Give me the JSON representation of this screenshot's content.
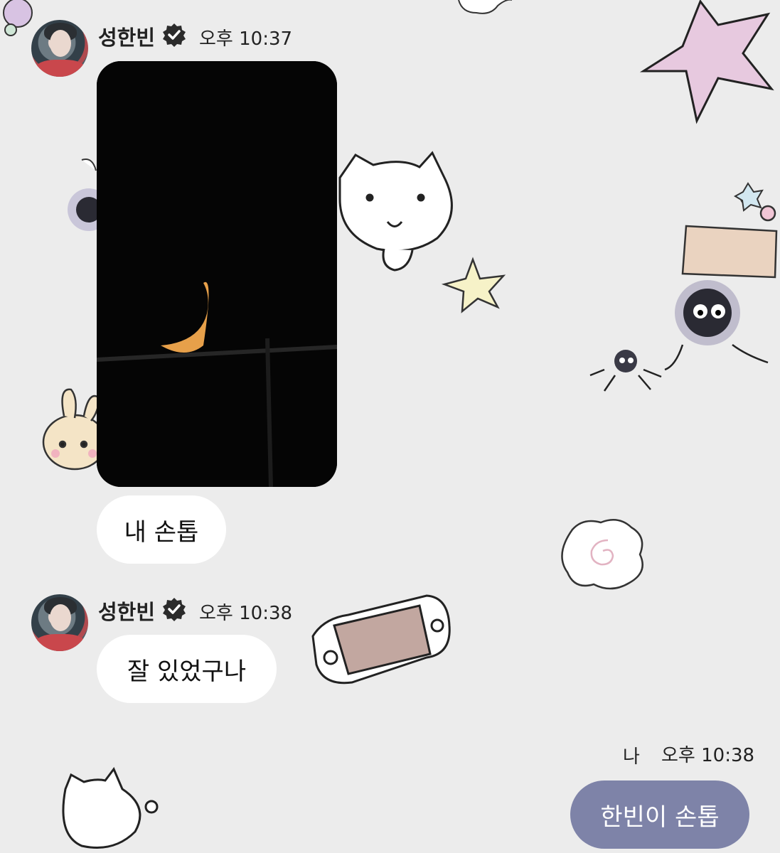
{
  "messages": [
    {
      "sender": "성한빈",
      "time": "오후 10:37",
      "items": [
        "내 손톱"
      ]
    },
    {
      "sender": "성한빈",
      "time": "오후 10:38",
      "items": [
        "잘 있었구나"
      ]
    }
  ],
  "my_message": {
    "me_label": "나",
    "time": "오후 10:38",
    "text": "한빈이 손톱"
  },
  "colors": {
    "background": "#ececec",
    "my_bubble": "#7e83a8",
    "other_bubble": "#ffffff"
  },
  "icons": {
    "verified": "verified-check-badge-icon"
  }
}
